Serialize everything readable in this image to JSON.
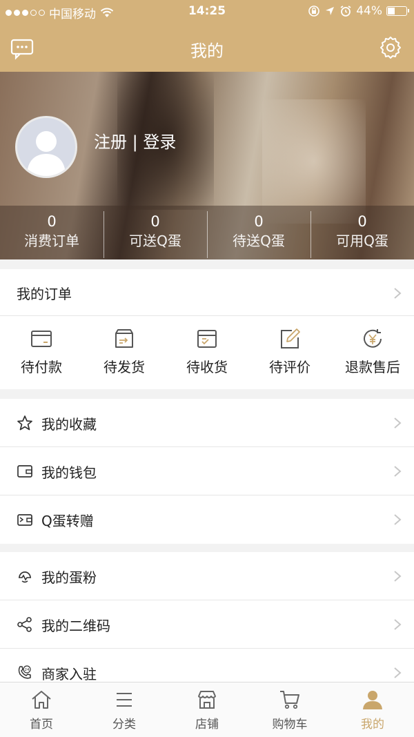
{
  "status_bar": {
    "carrier": "中国移动",
    "time": "14:25",
    "battery": "44%",
    "battery_level": 0.44
  },
  "header": {
    "title": "我的"
  },
  "profile": {
    "login_text": "注册 | 登录",
    "stats": [
      {
        "value": "0",
        "label": "消费订单"
      },
      {
        "value": "0",
        "label": "可送Q蛋"
      },
      {
        "value": "0",
        "label": "待送Q蛋"
      },
      {
        "value": "0",
        "label": "可用Q蛋"
      }
    ]
  },
  "orders": {
    "title": "我的订单",
    "statuses": [
      {
        "label": "待付款",
        "icon": "wallet-card-icon"
      },
      {
        "label": "待发货",
        "icon": "shipping-box-icon"
      },
      {
        "label": "待收货",
        "icon": "receive-box-icon"
      },
      {
        "label": "待评价",
        "icon": "edit-review-icon"
      },
      {
        "label": "退款售后",
        "icon": "refund-yen-icon"
      }
    ]
  },
  "menu_group_1": [
    {
      "label": "我的收藏",
      "icon": "star-icon"
    },
    {
      "label": "我的钱包",
      "icon": "wallet-icon"
    },
    {
      "label": "Q蛋转赠",
      "icon": "transfer-wallet-icon"
    }
  ],
  "menu_group_2": [
    {
      "label": "我的蛋粉",
      "icon": "fans-icon"
    },
    {
      "label": "我的二维码",
      "icon": "share-icon"
    },
    {
      "label": "商家入驻",
      "icon": "phone-24-icon"
    }
  ],
  "tab_bar": {
    "active": "我的",
    "tabs": [
      {
        "label": "首页",
        "icon": "home-icon"
      },
      {
        "label": "分类",
        "icon": "category-icon"
      },
      {
        "label": "店铺",
        "icon": "store-icon"
      },
      {
        "label": "购物车",
        "icon": "cart-icon"
      },
      {
        "label": "我的",
        "icon": "user-icon"
      }
    ]
  },
  "colors": {
    "brand": "#d4b27b",
    "tab_active": "#c9a66b"
  }
}
